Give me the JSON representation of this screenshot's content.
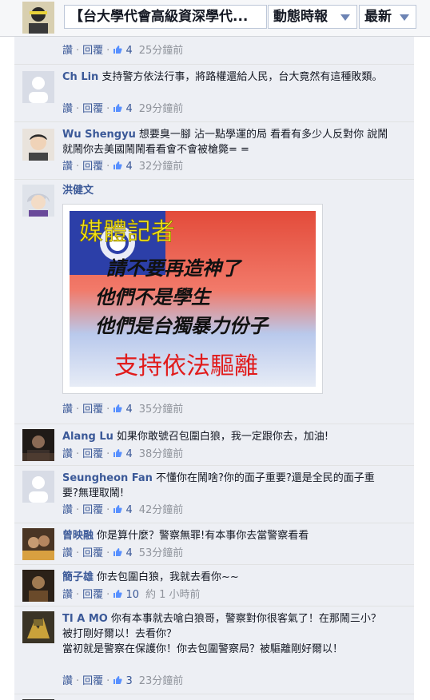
{
  "header": {
    "page_title": "【台大學代會高級資深學代...",
    "filter_label": "動態時報",
    "sort_label": "最新"
  },
  "actions_labels": {
    "like": "讚",
    "reply": "回覆"
  },
  "comments": [
    {
      "author": "",
      "text": "",
      "likes": "4",
      "time": "25分鐘前"
    },
    {
      "author": "Ch Lin",
      "text": "支持警方依法行事，將路權還給人民，台大竟然有這種敗類。",
      "likes": "4",
      "time": "29分鐘前"
    },
    {
      "author": "Wu Shengyu",
      "text": "想要臭一腳 沾一點學運的局 看看有多少人反對你 說鬧就鬧你去美國鬧鬧看看會不會被槍斃= =",
      "likes": "4",
      "time": "32分鐘前"
    },
    {
      "author": "洪健文",
      "text": "",
      "likes": "4",
      "time": "35分鐘前",
      "photo": {
        "line1": "媒體記者",
        "line2": "請不要再造神了",
        "line3": "他們不是學生",
        "line4": "他們是台獨暴力份子",
        "line5": "支持依法驅離"
      }
    },
    {
      "author": "Alang Lu",
      "text": "如果你敢號召包圍白狼，我一定跟你去，加油!",
      "likes": "4",
      "time": "38分鐘前"
    },
    {
      "author": "Seungheon Fan",
      "text": "不懂你在鬧啥?你的面子重要?還是全民的面子重要?無理取鬧!",
      "likes": "4",
      "time": "42分鐘前"
    },
    {
      "author": "曾映融",
      "text": "你是算什麼？警察無罪!有本事你去當警察看看",
      "likes": "4",
      "time": "53分鐘前"
    },
    {
      "author": "簡子雄",
      "text": "你去包圍白狼，我就去看你~~",
      "likes": "10",
      "time": "約 1 小時前"
    },
    {
      "author": "TI A MO",
      "text": "你有本事就去嗆白狼哥，警察對你很客氣了！在那鬧三小？",
      "text2": "被打剛好爾以！去看你？",
      "text3": "當初就是警察在保護你！你去包圍警察局？被驅離剛好爾以！",
      "likes": "3",
      "time": "23分鐘前"
    }
  ],
  "colors": {
    "link": "#3b5998",
    "meta": "#90949c",
    "feed_bg": "#edeff4"
  }
}
